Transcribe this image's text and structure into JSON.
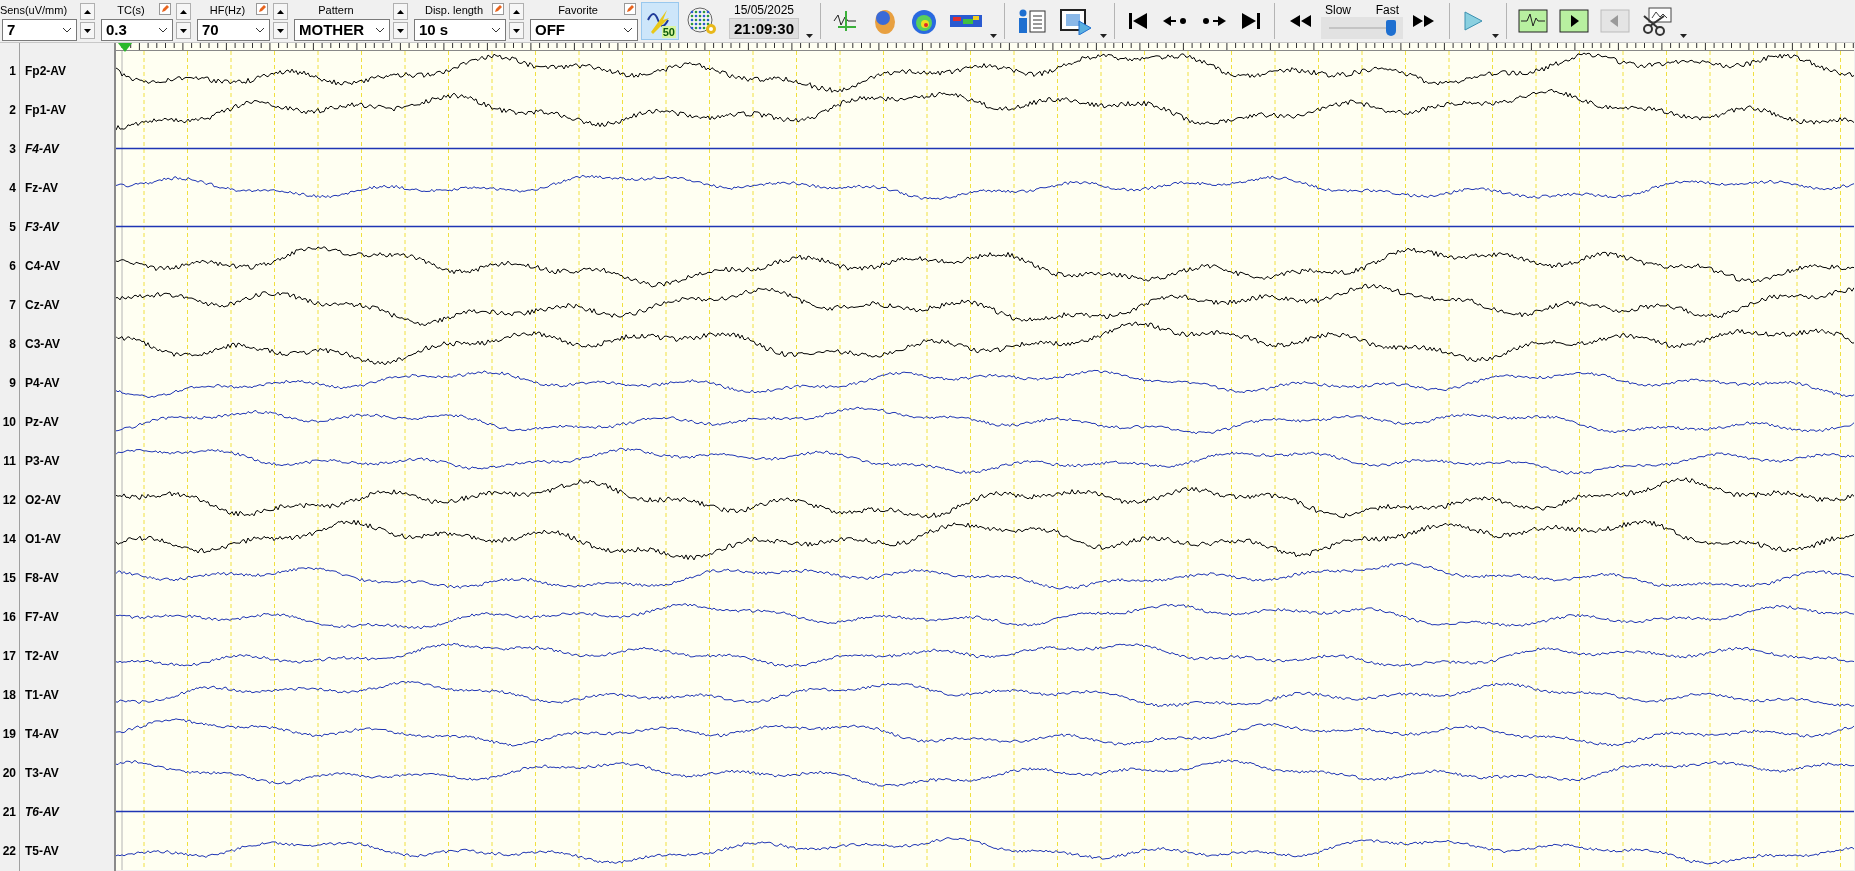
{
  "toolbar": {
    "selectors": [
      {
        "label": "Sens(uV/mm)",
        "value": "7",
        "editable": false,
        "spin": true
      },
      {
        "label": "TC(s)",
        "value": "0.3",
        "editable": true,
        "spin": true
      },
      {
        "label": "HF(Hz)",
        "value": "70",
        "editable": true,
        "spin": true
      },
      {
        "label": "Pattern",
        "value": "MOTHER",
        "editable": false,
        "spin": true
      },
      {
        "label": "Disp. length",
        "value": "10 s",
        "editable": true,
        "spin": true
      },
      {
        "label": "Favorite",
        "value": "OFF",
        "editable": true,
        "spin": false
      }
    ],
    "filter_badge": "50",
    "date": "15/05/2025",
    "time": "21:09:30",
    "speed": {
      "slow_label": "Slow",
      "fast_label": "Fast",
      "level": 0.85
    }
  },
  "channels": [
    {
      "number": "1",
      "name": "Fp2-AV",
      "color": "#000000",
      "disabled": false
    },
    {
      "number": "2",
      "name": "Fp1-AV",
      "color": "#000000",
      "disabled": false
    },
    {
      "number": "3",
      "name": "F4-AV",
      "color": "#1f35b4",
      "disabled": true
    },
    {
      "number": "4",
      "name": "Fz-AV",
      "color": "#1f35b4",
      "disabled": false
    },
    {
      "number": "5",
      "name": "F3-AV",
      "color": "#1f35b4",
      "disabled": true
    },
    {
      "number": "6",
      "name": "C4-AV",
      "color": "#000000",
      "disabled": false
    },
    {
      "number": "7",
      "name": "Cz-AV",
      "color": "#000000",
      "disabled": false
    },
    {
      "number": "8",
      "name": "C3-AV",
      "color": "#000000",
      "disabled": false
    },
    {
      "number": "9",
      "name": "P4-AV",
      "color": "#1f35b4",
      "disabled": false
    },
    {
      "number": "10",
      "name": "Pz-AV",
      "color": "#1f35b4",
      "disabled": false
    },
    {
      "number": "11",
      "name": "P3-AV",
      "color": "#1f35b4",
      "disabled": false
    },
    {
      "number": "12",
      "name": "O2-AV",
      "color": "#000000",
      "disabled": false
    },
    {
      "number": "14",
      "name": "O1-AV",
      "color": "#000000",
      "disabled": false
    },
    {
      "number": "15",
      "name": "F8-AV",
      "color": "#1f35b4",
      "disabled": false
    },
    {
      "number": "16",
      "name": "F7-AV",
      "color": "#1f35b4",
      "disabled": false
    },
    {
      "number": "17",
      "name": "T2-AV",
      "color": "#1f35b4",
      "disabled": false
    },
    {
      "number": "18",
      "name": "T1-AV",
      "color": "#1f35b4",
      "disabled": false
    },
    {
      "number": "19",
      "name": "T4-AV",
      "color": "#1f35b4",
      "disabled": false
    },
    {
      "number": "20",
      "name": "T3-AV",
      "color": "#1f35b4",
      "disabled": false
    },
    {
      "number": "21",
      "name": "T6-AV",
      "color": "#1f35b4",
      "disabled": true
    },
    {
      "number": "22",
      "name": "T5-AV",
      "color": "#1f35b4",
      "disabled": false
    }
  ]
}
